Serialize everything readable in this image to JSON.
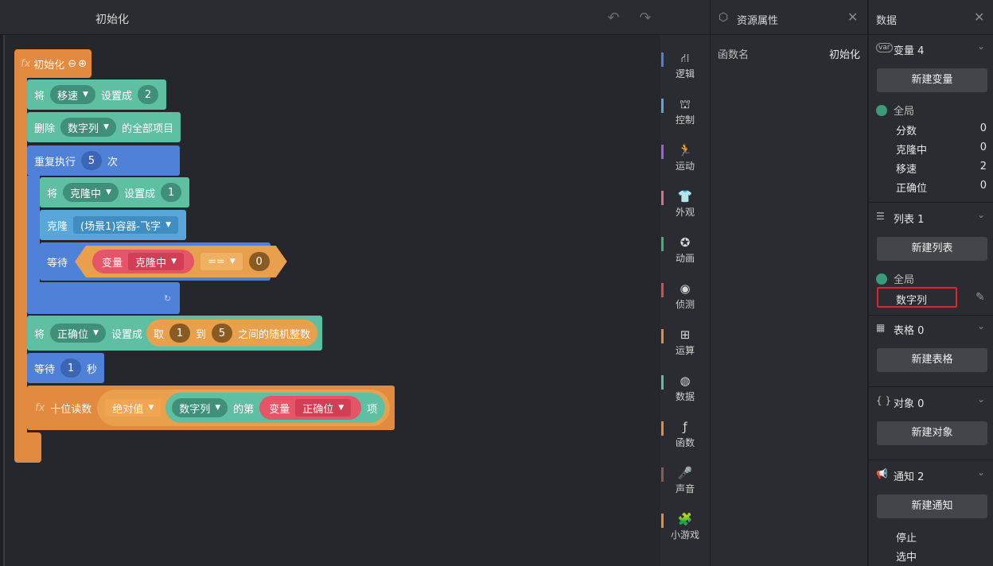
{
  "workspace": {
    "title": "初始化",
    "undo_icon": "undo-icon",
    "redo_icon": "redo-icon"
  },
  "blocks": {
    "hat": {
      "fx": "fx",
      "label": "初始化",
      "minus": "⊖",
      "plus": "⊕"
    },
    "set_speed": {
      "verb": "将",
      "var": "移速",
      "to": "设置成",
      "value": "2"
    },
    "delete_all": {
      "verb": "删除",
      "list": "数字列",
      "suffix": "的全部项目"
    },
    "repeat": {
      "label": "重复执行",
      "count": "5",
      "suffix": "次"
    },
    "set_cloning": {
      "verb": "将",
      "var": "克隆中",
      "to": "设置成",
      "value": "1"
    },
    "clone": {
      "verb": "克隆",
      "target": "(场景1)容器-飞字"
    },
    "wait_until": {
      "label": "等待",
      "var_kw": "变量",
      "var": "克隆中",
      "op": "==",
      "value": "0"
    },
    "set_pos": {
      "verb": "将",
      "var": "正确位",
      "to": "设置成",
      "rand_kw": "取",
      "from": "1",
      "to_kw": "到",
      "to_val": "5",
      "rand_suffix": "之间的随机整数"
    },
    "wait_sec": {
      "label": "等待",
      "value": "1",
      "unit": "秒"
    },
    "func_call": {
      "fx": "fx",
      "label": "十位读数",
      "abs": "绝对值",
      "list": "数字列",
      "of": "的第",
      "var_kw": "变量",
      "var": "正确位",
      "item": "项"
    }
  },
  "categories": [
    {
      "label": "逻辑",
      "icon": "logic-icon",
      "color": "#4f81d9"
    },
    {
      "label": "控制",
      "icon": "control-icon",
      "color": "#58a7d8"
    },
    {
      "label": "运动",
      "icon": "motion-icon",
      "color": "#9b5fe0"
    },
    {
      "label": "外观",
      "icon": "looks-icon",
      "color": "#e06a8a"
    },
    {
      "label": "动画",
      "icon": "animation-icon",
      "color": "#3cb371"
    },
    {
      "label": "侦测",
      "icon": "sensing-icon",
      "color": "#e04a4a"
    },
    {
      "label": "运算",
      "icon": "operator-icon",
      "color": "#e28a3f"
    },
    {
      "label": "数据",
      "icon": "data-icon",
      "color": "#5fbfa3"
    },
    {
      "label": "函数",
      "icon": "function-icon",
      "color": "#e28a3f"
    },
    {
      "label": "声音",
      "icon": "sound-icon",
      "color": "#8a5a4a"
    },
    {
      "label": "小游戏",
      "icon": "minigame-icon",
      "color": "#e28a3f"
    }
  ],
  "resource": {
    "title": "资源属性",
    "label": "函数名",
    "value": "初始化"
  },
  "data_panel": {
    "title": "数据",
    "variables": {
      "title": "变量 4",
      "new_btn": "新建变量",
      "scope": "全局",
      "items": [
        {
          "name": "分数",
          "value": "0"
        },
        {
          "name": "克隆中",
          "value": "0"
        },
        {
          "name": "移速",
          "value": "2"
        },
        {
          "name": "正确位",
          "value": "0"
        }
      ]
    },
    "lists": {
      "title": "列表 1",
      "new_btn": "新建列表",
      "scope": "全局",
      "item": "数字列"
    },
    "tables": {
      "title": "表格 0",
      "new_btn": "新建表格"
    },
    "objects": {
      "title": "对象 0",
      "new_btn": "新建对象"
    },
    "notices": {
      "title": "通知 2",
      "new_btn": "新建通知",
      "items": [
        "停止",
        "选中"
      ]
    }
  }
}
